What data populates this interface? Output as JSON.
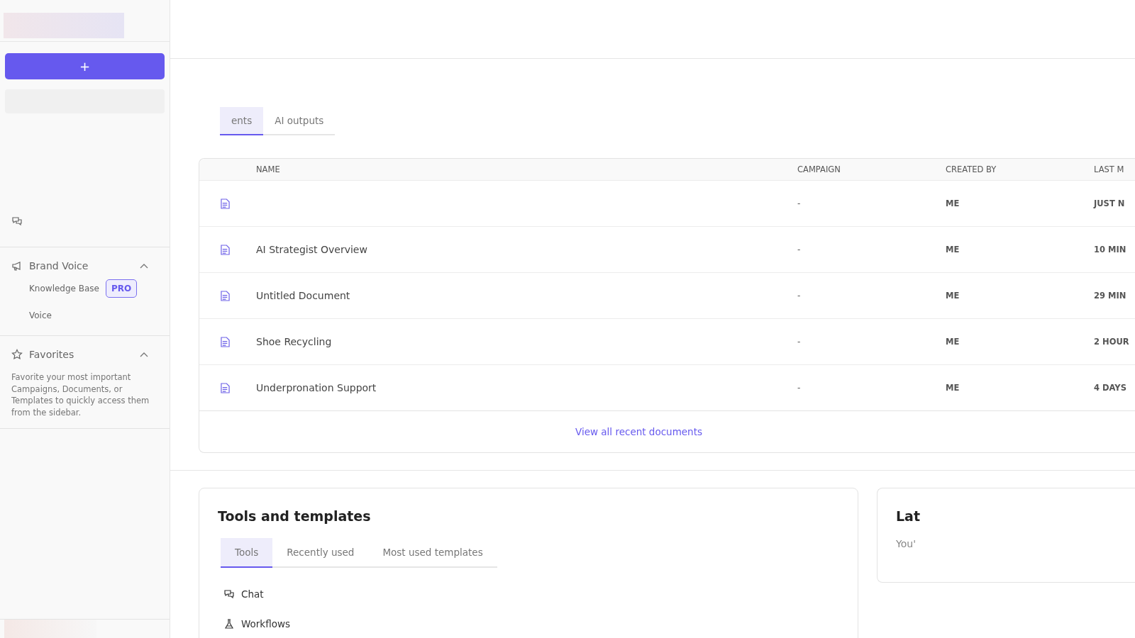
{
  "sidebar": {
    "new_button": {
      "label": "+"
    },
    "sections": [
      {
        "kind": "group",
        "title": "Brand Voice",
        "expanded": true,
        "items": [
          {
            "label": "Knowledge Base",
            "badge": "PRO"
          },
          {
            "label": "Voice"
          }
        ]
      },
      {
        "kind": "note",
        "title": "Favorites",
        "expanded": true,
        "text": "Favorite your most important Campaigns, Documents, or Templates to quickly access them from the sidebar."
      }
    ]
  },
  "recent": {
    "tabs": [
      {
        "label": "ents",
        "selected": true
      },
      {
        "label": "AI outputs",
        "selected": false
      }
    ],
    "columns": [
      "NAME",
      "CAMPAIGN",
      "CREATED BY",
      "LAST M"
    ],
    "rows": [
      {
        "name": "",
        "campaign": "-",
        "created_by": "ME",
        "last": "JUST N"
      },
      {
        "name": "AI Strategist Overview",
        "campaign": "-",
        "created_by": "ME",
        "last": "10 MIN"
      },
      {
        "name": "Untitled Document",
        "campaign": "-",
        "created_by": "ME",
        "last": "29 MIN"
      },
      {
        "name": "Shoe Recycling",
        "campaign": "-",
        "created_by": "ME",
        "last": "2 HOUR"
      },
      {
        "name": "Underpronation Support",
        "campaign": "-",
        "created_by": "ME",
        "last": "4 DAYS"
      }
    ],
    "view_all": "View all recent documents"
  },
  "tools": {
    "title": "Tools and templates",
    "tabs": [
      {
        "label": "Tools",
        "selected": true
      },
      {
        "label": "Recently used",
        "selected": false
      },
      {
        "label": "Most used templates",
        "selected": false
      }
    ],
    "items": [
      {
        "label": "Chat"
      },
      {
        "label": "Workflows"
      }
    ]
  },
  "latest": {
    "title": "Lat",
    "text": "You'"
  }
}
